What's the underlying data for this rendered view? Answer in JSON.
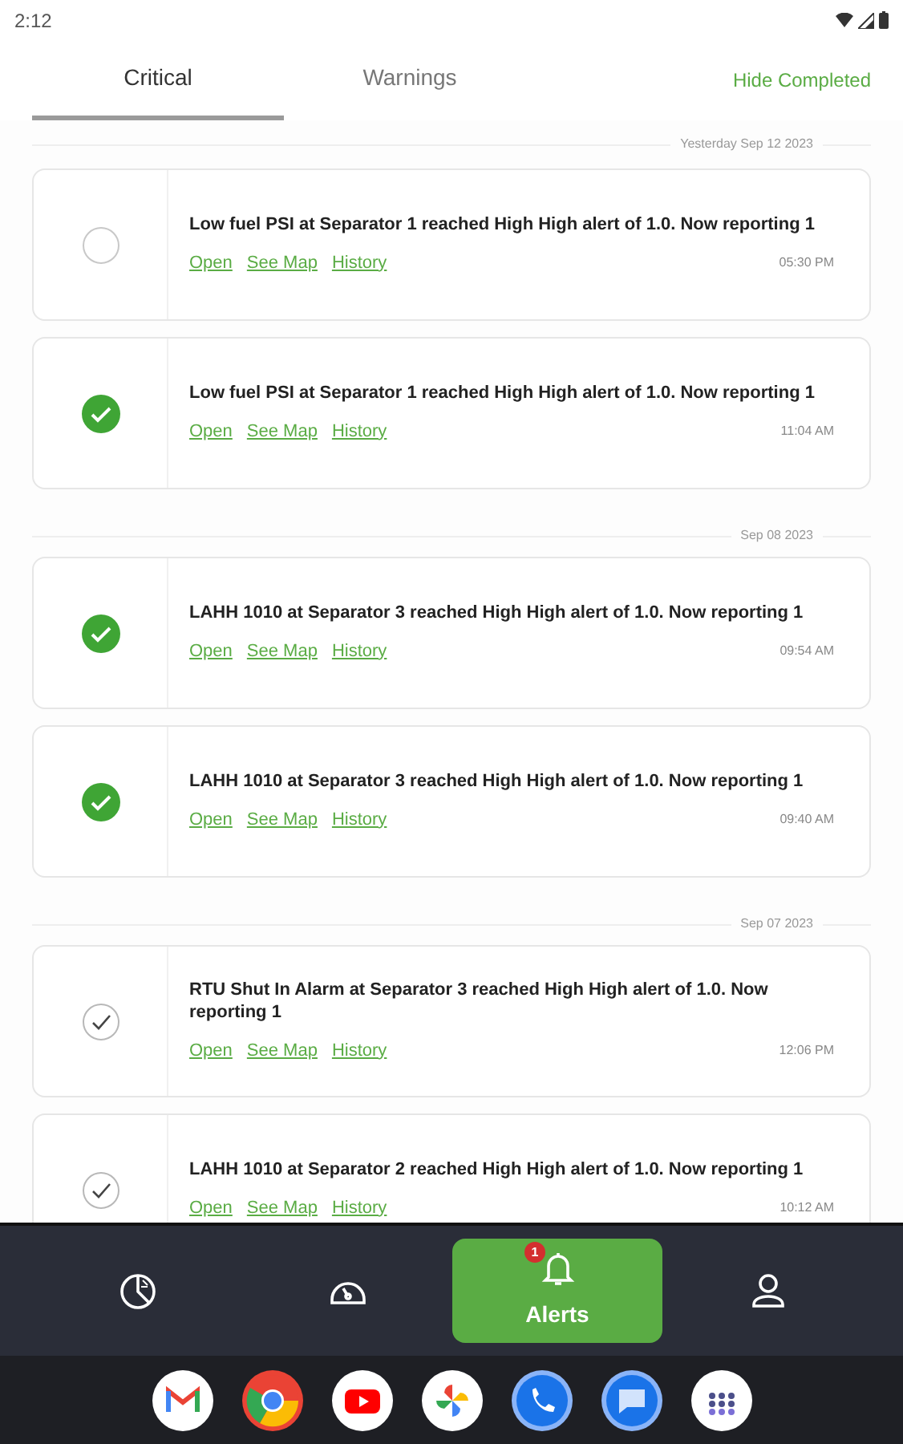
{
  "status_bar": {
    "time": "2:12"
  },
  "tabs": [
    {
      "label": "Critical",
      "selected": true
    },
    {
      "label": "Warnings",
      "selected": false
    }
  ],
  "hide_completed": "Hide Completed",
  "groups": [
    {
      "date": "Yesterday Sep 12 2023",
      "alerts": [
        {
          "kind": "open",
          "message": "Low fuel PSI at Separator 1 reached High High alert of 1.0. Now reporting 1",
          "links": [
            "Open",
            "See Map",
            "History"
          ],
          "time": "05:30 PM"
        },
        {
          "kind": "acknowledged",
          "message": "Low fuel PSI at Separator 1 reached High High alert of 1.0. Now reporting 1",
          "links": [
            "Open",
            "See Map",
            "History"
          ],
          "time": "11:04 AM"
        }
      ]
    },
    {
      "date": "Sep 08 2023",
      "alerts": [
        {
          "kind": "acknowledged",
          "message": "LAHH 1010 at Separator 3 reached High High alert of 1.0. Now reporting 1",
          "links": [
            "Open",
            "See Map",
            "History"
          ],
          "time": "09:54 AM"
        },
        {
          "kind": "acknowledged",
          "message": "LAHH 1010 at Separator 3 reached High High alert of 1.0. Now reporting 1",
          "links": [
            "Open",
            "See Map",
            "History"
          ],
          "time": "09:40 AM"
        }
      ]
    },
    {
      "date": "Sep 07 2023",
      "alerts": [
        {
          "kind": "completed",
          "message": "RTU Shut In Alarm at Separator 3 reached High High alert of 1.0. Now reporting 1",
          "links": [
            "Open",
            "See Map",
            "History"
          ],
          "time": "12:06 PM"
        },
        {
          "kind": "completed",
          "message": "LAHH 1010 at Separator 2 reached High High alert of 1.0. Now reporting 1",
          "links": [
            "Open",
            "See Map",
            "History"
          ],
          "time": "10:12 AM"
        }
      ]
    }
  ],
  "nav": [
    {
      "selected": false
    },
    {
      "selected": false
    },
    {
      "selected": true,
      "label": "Alerts",
      "badge": "1"
    },
    {
      "selected": false
    }
  ]
}
